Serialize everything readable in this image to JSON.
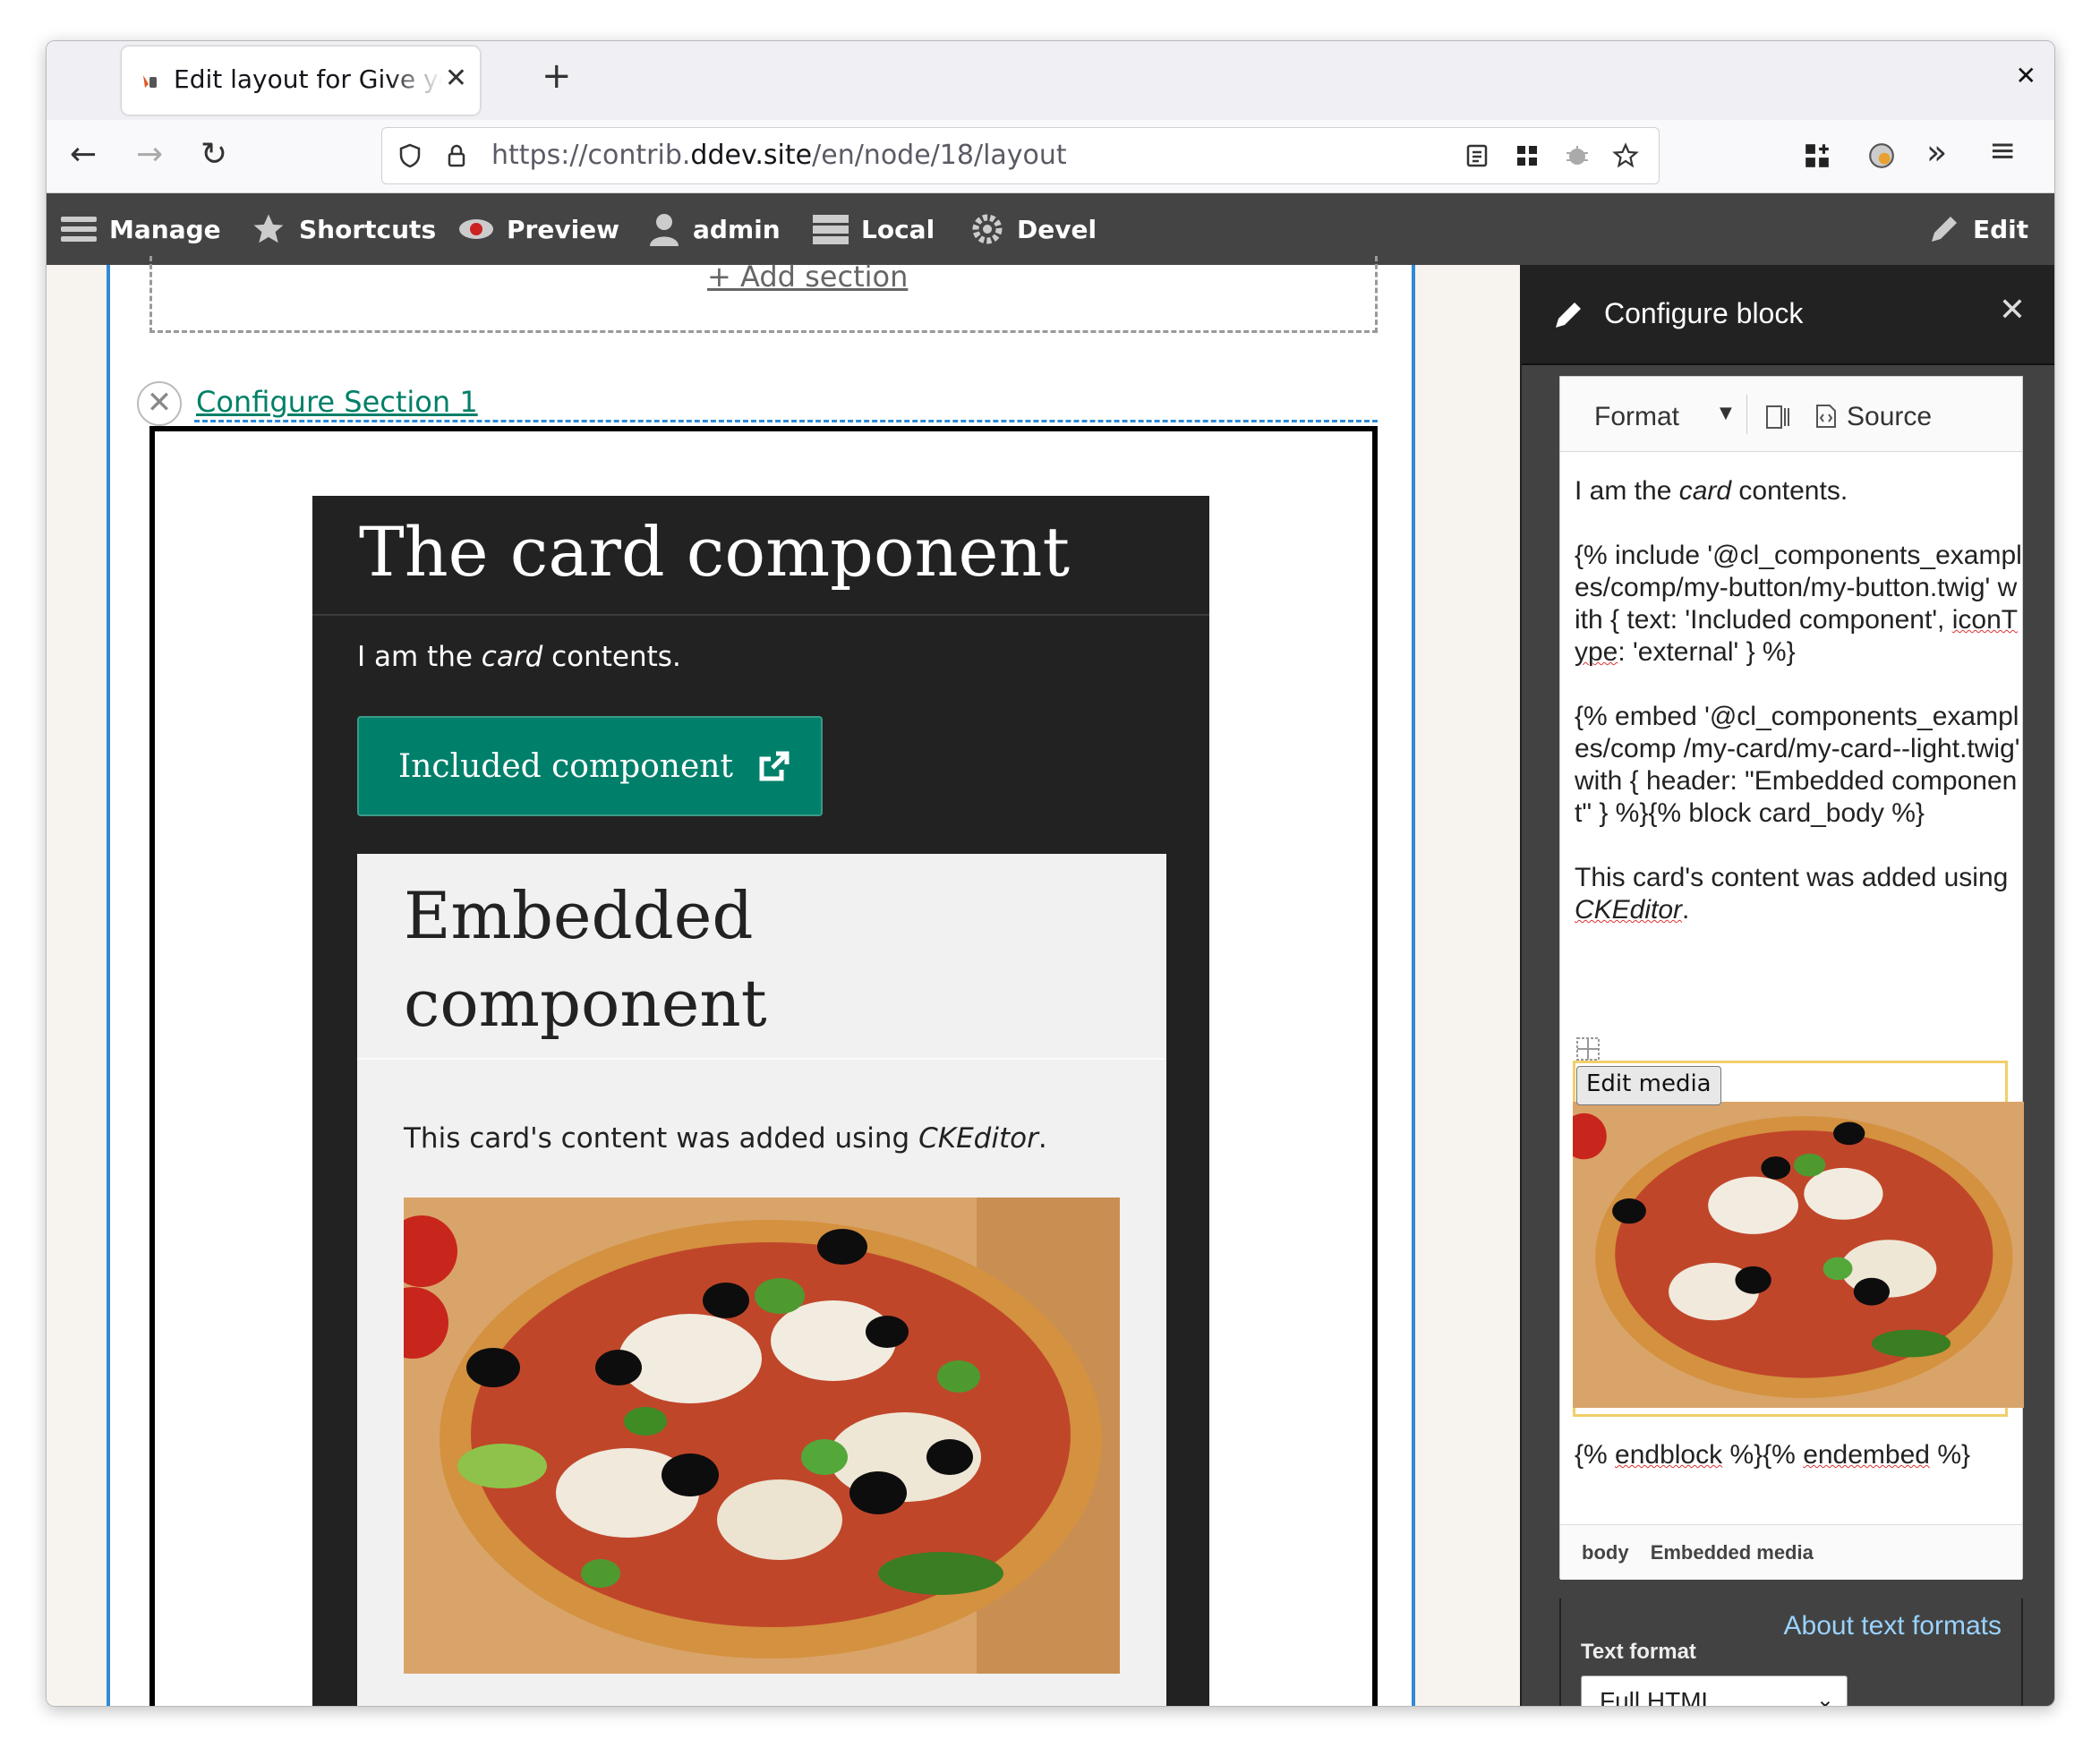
{
  "browser": {
    "tab_title": "Edit layout for Give your o",
    "url_prefix": "https://contrib.",
    "url_host": "ddev.site",
    "url_path": "/en/node/18/layout"
  },
  "toolbar": {
    "manage": "Manage",
    "shortcuts": "Shortcuts",
    "preview": "Preview",
    "user": "admin",
    "local": "Local",
    "devel": "Devel",
    "edit": "Edit"
  },
  "layout": {
    "add_section": "Add section",
    "configure_section": "Configure Section 1"
  },
  "card": {
    "title": "The card component",
    "text_before": "I am the ",
    "text_em": "card",
    "text_after": " contents.",
    "button_label": "Included component",
    "embedded": {
      "title": "Embedded component",
      "text_before": "This card's content was added using ",
      "text_em": "CKEditor",
      "text_after": "."
    }
  },
  "sidebar": {
    "title": "Configure block",
    "ck": {
      "format": "Format",
      "source": "Source",
      "p1_before": "I am the ",
      "p1_em": "card",
      "p1_after": " contents.",
      "p2_a": "{% include '@cl_components_examples/comp",
      "p2_b": "/my-button/my-button.twig' with { text: 'Included component', ",
      "p2_spell": "iconType",
      "p2_c": ": 'external' } %}",
      "p3": "{% embed '@cl_components_examples/comp /my-card/my-card--light.twig' with { header: \"Embedded component\" } %}{% block card_body %}",
      "p4_before": "This card's content was added using ",
      "p4_em": "CKEditor",
      "p4_after": ".",
      "edit_media": "Edit media",
      "end_a": "{% ",
      "end_spell1": "endblock",
      "end_b": " %}{% ",
      "end_spell2": "endembed",
      "end_c": " %}",
      "path_body": "body",
      "path_media": "Embedded media"
    },
    "text_format": {
      "about": "About text formats",
      "label": "Text format",
      "selected": "Full HTML"
    }
  },
  "colors": {
    "accent_blue": "#2f8ad8",
    "button_green": "#00806b",
    "card_dark": "#222222",
    "toolbar_gray": "#444444"
  }
}
